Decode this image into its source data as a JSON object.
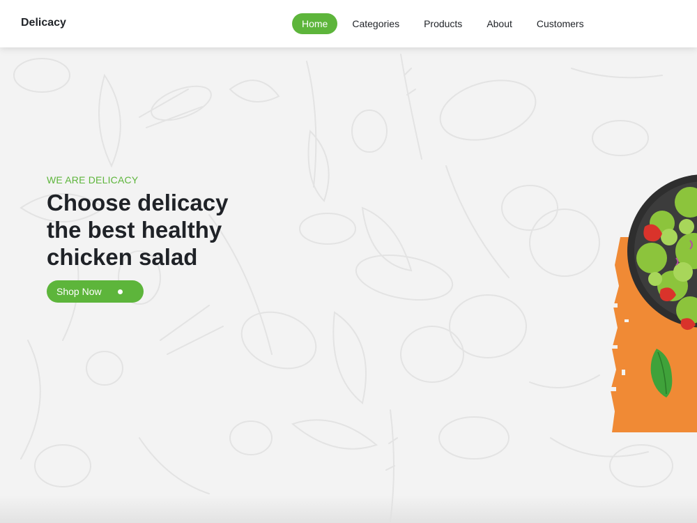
{
  "brand": {
    "name": "Delicacy"
  },
  "nav": {
    "items": [
      {
        "label": "Home",
        "active": true
      },
      {
        "label": "Categories",
        "active": false
      },
      {
        "label": "Products",
        "active": false
      },
      {
        "label": "About",
        "active": false
      },
      {
        "label": "Customers",
        "active": false
      }
    ]
  },
  "hero": {
    "eyebrow": "WE ARE DELICACY",
    "headline_lines": [
      "Choose delicacy",
      "the best healthy",
      "chicken salad"
    ],
    "cta_label": "Shop Now"
  },
  "colors": {
    "accent": "#5db53b",
    "orange": "#f08a35",
    "text": "#1f2227",
    "background": "#f3f3f3"
  },
  "icons": {
    "cta": "dot-icon",
    "hero_image": "salad-bowl-illustration",
    "leaf": "basil-leaf-icon"
  }
}
